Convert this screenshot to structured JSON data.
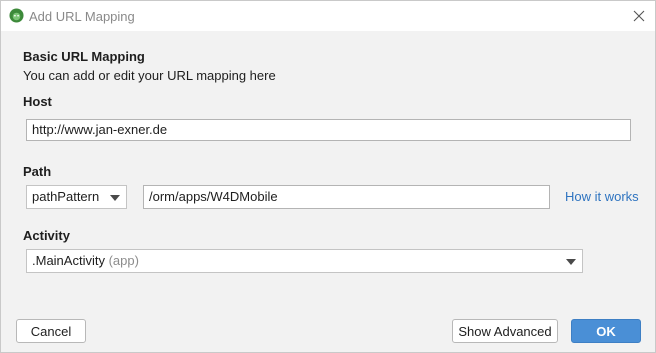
{
  "window": {
    "title": "Add URL Mapping",
    "close_icon": "close-icon",
    "app_icon": "android-studio-icon"
  },
  "section": {
    "heading": "Basic URL Mapping",
    "description": "You can add or edit your URL mapping here"
  },
  "host": {
    "label": "Host",
    "value": "http://www.jan-exner.de"
  },
  "path": {
    "label": "Path",
    "type_selected": "pathPattern",
    "value": "/orm/apps/W4DMobile",
    "help_link": "How it works"
  },
  "activity": {
    "label": "Activity",
    "selected_name": ".MainActivity",
    "selected_module": "(app)"
  },
  "buttons": {
    "cancel": "Cancel",
    "show_advanced": "Show Advanced",
    "ok": "OK"
  },
  "colors": {
    "accent": "#4a8fd6",
    "link": "#2f74c0",
    "background": "#f2f2f2"
  }
}
